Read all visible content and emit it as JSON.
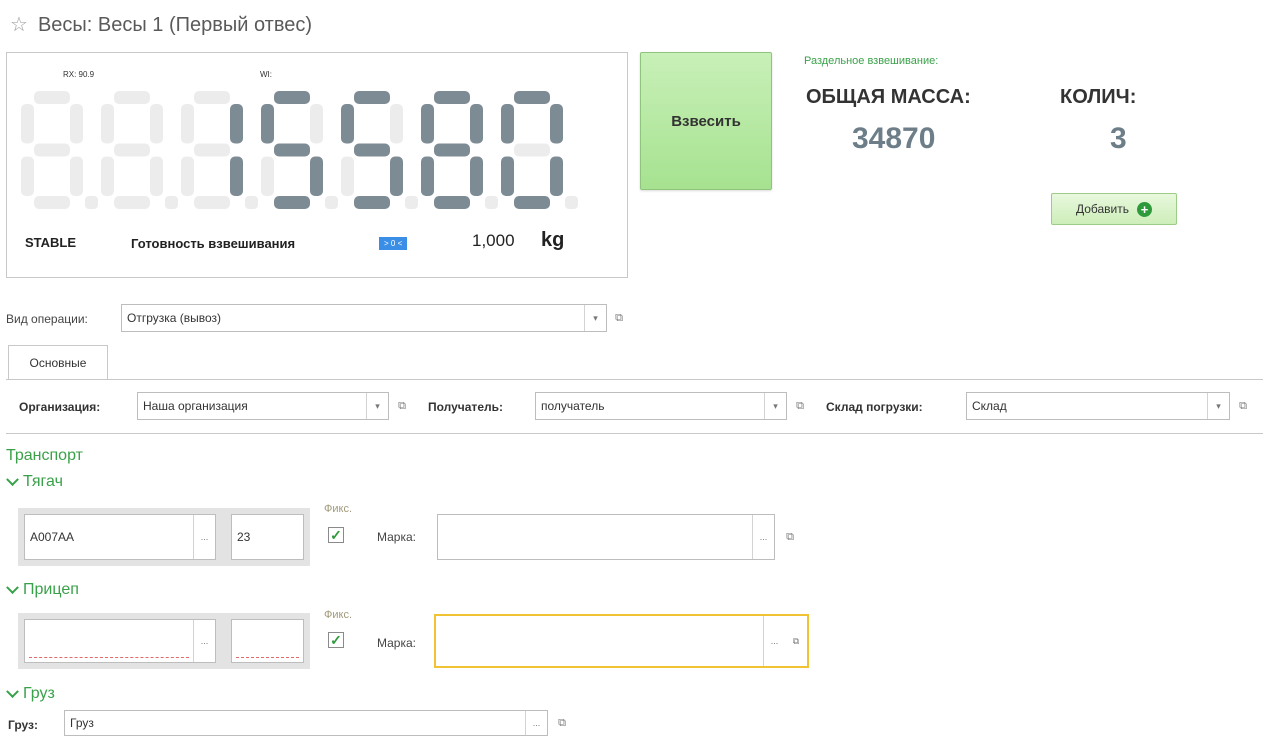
{
  "title": {
    "star_icon": "star-icon",
    "text": "Весы: Весы 1 (Первый отвес)"
  },
  "scale": {
    "rx_label": "RX: 90.9",
    "wi_label": "WI:",
    "reading": "15580",
    "status": "STABLE",
    "ready_label": "Готовность взвешивания",
    "indicator": "> 0 <",
    "factor": "1,000",
    "unit": "kg"
  },
  "weigh_button": "Взвесить",
  "totals": {
    "split_label": "Раздельное взвешивание:",
    "total_mass_label": "ОБЩАЯ МАССА:",
    "total_mass_value": "34870",
    "count_label": "КОЛИЧ:",
    "count_value": "3",
    "add_button": "Добавить"
  },
  "operation": {
    "label": "Вид операции:",
    "value": "Отгрузка (вывоз)"
  },
  "tabs": [
    {
      "label": "Основные"
    }
  ],
  "main_fields": {
    "org_label": "Организация:",
    "org_value": "Наша организация",
    "recipient_label": "Получатель:",
    "recipient_value": "получатель",
    "warehouse_label": "Склад погрузки:",
    "warehouse_value": "Склад"
  },
  "transport": {
    "heading": "Транспорт",
    "tractor": {
      "heading": "Тягач",
      "plate": "А007АА",
      "region": "23",
      "fix_label": "Фикс.",
      "fixed": true,
      "brand_label": "Марка:",
      "brand_value": ""
    },
    "trailer": {
      "heading": "Прицеп",
      "plate": "",
      "region": "",
      "fix_label": "Фикс.",
      "fixed": true,
      "brand_label": "Марка:",
      "brand_value": ""
    }
  },
  "cargo": {
    "heading": "Груз",
    "label": "Груз:",
    "value": "Груз"
  },
  "colors": {
    "accent_green": "#3aa14a",
    "segment_on": "#7d8b94",
    "segment_off": "#ececec",
    "highlight": "#f1c232"
  }
}
